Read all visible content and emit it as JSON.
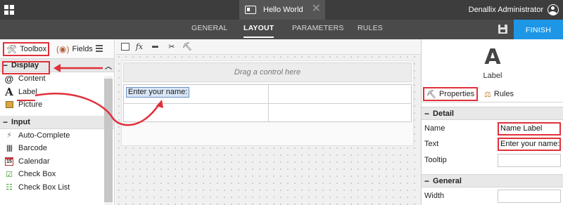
{
  "topbar": {
    "document_title": "Hello World",
    "close_glyph": "✕",
    "user_name": "Denallix Administrator"
  },
  "nav": {
    "tabs": [
      {
        "label": "GENERAL",
        "active": false
      },
      {
        "label": "LAYOUT",
        "active": true
      },
      {
        "label": "PARAMETERS",
        "active": false
      },
      {
        "label": "RULES",
        "active": false
      }
    ],
    "finish_label": "FINISH"
  },
  "left_panel": {
    "tabs": {
      "toolbox": "Toolbox",
      "fields": "Fields"
    },
    "display_section": {
      "title": "Display",
      "items": [
        {
          "label": "Content",
          "icon": "content-icon"
        },
        {
          "label": "Label",
          "icon": "label-icon"
        },
        {
          "label": "Picture",
          "icon": "picture-icon"
        }
      ]
    },
    "input_section": {
      "title": "Input",
      "items": [
        {
          "label": "Auto-Complete",
          "icon": "lightning-icon"
        },
        {
          "label": "Barcode",
          "icon": "barcode-icon"
        },
        {
          "label": "Calendar",
          "icon": "calendar-icon"
        },
        {
          "label": "Check Box",
          "icon": "checkbox-icon"
        },
        {
          "label": "Check Box List",
          "icon": "checkbox-list-icon"
        }
      ]
    }
  },
  "canvas": {
    "toolbar_icons": [
      "add-view-icon",
      "expression-icon",
      "more-icon",
      "rules-toggle-icon",
      "form-properties-icon"
    ],
    "fx_glyph": "fx",
    "drag_hint": "Drag a control here",
    "label_control_text": "Enter your name:"
  },
  "right_panel": {
    "control_glyph": "A",
    "control_type": "Label",
    "tabs": {
      "properties": "Properties",
      "rules": "Rules"
    },
    "detail_section": {
      "title": "Detail",
      "rows": [
        {
          "label": "Name",
          "value": "Name Label"
        },
        {
          "label": "Text",
          "value": "Enter your name:"
        },
        {
          "label": "Tooltip",
          "value": ""
        }
      ]
    },
    "general_section": {
      "title": "General",
      "rows": [
        {
          "label": "Width",
          "value": ""
        }
      ]
    }
  },
  "colors": {
    "topbar": "#3d3d3d",
    "navbar": "#4a4a4a",
    "finish_button": "#1e96e6",
    "annotation_red": "#e0303a",
    "selected_control": "#d8e6f7"
  }
}
